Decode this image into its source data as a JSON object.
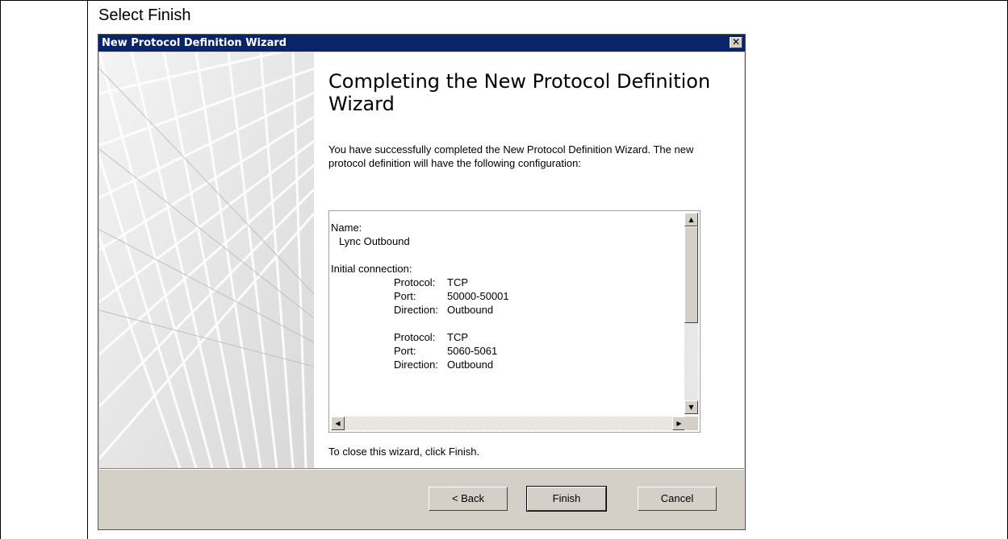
{
  "document": {
    "caption": "Select Finish"
  },
  "dialog": {
    "title": "New Protocol Definition Wizard",
    "close_glyph": "✕",
    "heading": "Completing the New Protocol Definition Wizard",
    "intro": "You have successfully completed the New Protocol Definition Wizard. The new protocol definition will have the following configuration:",
    "summary": {
      "name_label": "Name:",
      "name_value": "Lync Outbound",
      "initial_label": "Initial connection:",
      "connections": [
        {
          "protocol_label": "Protocol:",
          "protocol": "TCP",
          "port_label": "Port:",
          "port": "50000-50001",
          "direction_label": "Direction:",
          "direction": "Outbound"
        },
        {
          "protocol_label": "Protocol:",
          "protocol": "TCP",
          "port_label": "Port:",
          "port": "5060-5061",
          "direction_label": "Direction:",
          "direction": "Outbound"
        }
      ]
    },
    "footer_note": "To close this wizard, click Finish.",
    "buttons": {
      "back": "< Back",
      "finish": "Finish",
      "cancel": "Cancel"
    }
  }
}
